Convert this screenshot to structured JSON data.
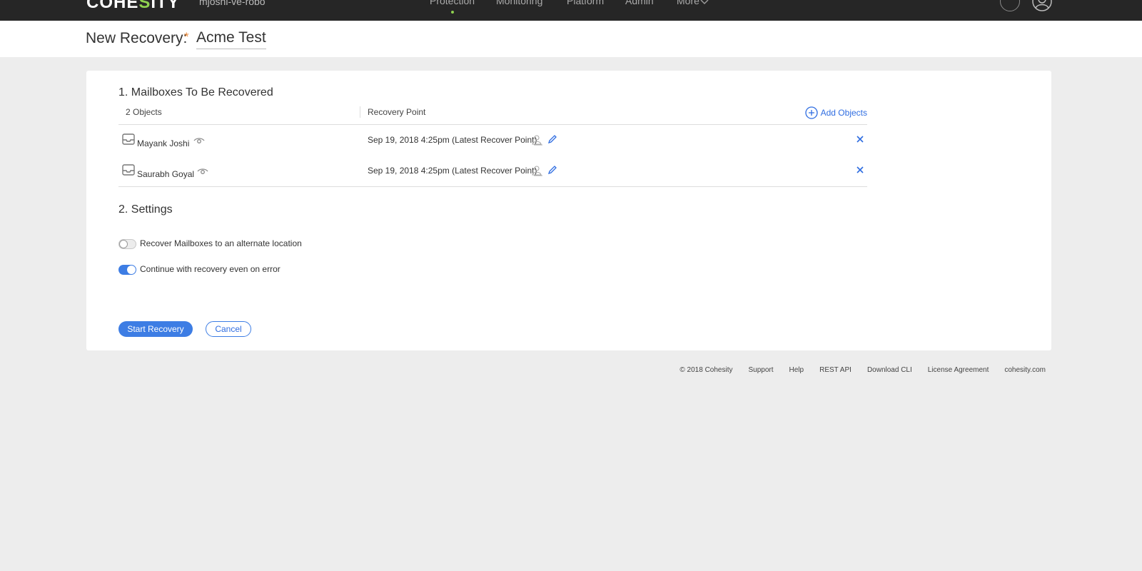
{
  "topbar": {
    "logo_prefix": "COHE",
    "logo_accent": "S",
    "logo_suffix": "ITY",
    "cluster_name": "mjoshi-ve-robo",
    "nav": [
      "Protection",
      "Monitoring",
      "Platform",
      "Admin",
      "More"
    ],
    "active_nav": "Protection"
  },
  "header": {
    "title": "New Recovery:",
    "required_marker": "*",
    "recovery_name": "Acme Test"
  },
  "mailboxes": {
    "section_title": "1. Mailboxes To Be Recovered",
    "objects_count": "2 Objects",
    "recovery_point_header": "Recovery Point",
    "add_objects_label": "Add Objects",
    "rows": [
      {
        "name": "Mayank Joshi",
        "recovery_point": "Sep 19, 2018 4:25pm (Latest Recover Point)"
      },
      {
        "name": "Saurabh Goyal",
        "recovery_point": "Sep 19, 2018 4:25pm (Latest Recover Point)"
      }
    ]
  },
  "settings": {
    "section_title": "2. Settings",
    "options": [
      {
        "label": "Recover Mailboxes to an alternate location",
        "enabled": false
      },
      {
        "label": "Continue with recovery even on error",
        "enabled": true
      }
    ]
  },
  "actions": {
    "start_label": "Start Recovery",
    "cancel_label": "Cancel"
  },
  "footer": {
    "links": [
      "© 2018 Cohesity",
      "Support",
      "Help",
      "REST API",
      "Download CLI",
      "License Agreement",
      "cohesity.com"
    ]
  },
  "colors": {
    "accent": "#3d7de4",
    "link": "#2f6de1",
    "brand_green": "#8fd14f",
    "topbar": "#262626"
  }
}
